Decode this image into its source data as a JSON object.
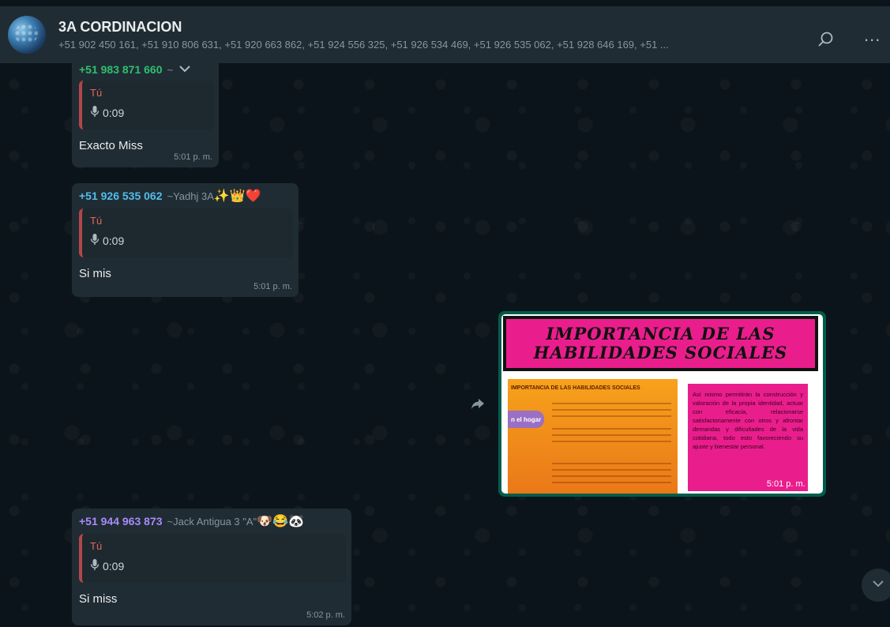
{
  "header": {
    "title": "3A CORDINACION",
    "participants": "+51 902 450 161, +51 910 806 631, +51 920 663 862, +51 924 556 325, +51 926 534 469, +51 926 535 062, +51 928 646 169, +51 ...",
    "search_icon": "search-icon",
    "menu_icon": "more-options-icon",
    "menu_label": "..."
  },
  "messages": [
    {
      "phone": "+51 983 871 660",
      "alias": "~",
      "phone_color": "#2fbf71",
      "quote_author": "Tú",
      "quote_duration": "0:09",
      "text": "Exacto Miss",
      "time": "5:01 p. m."
    },
    {
      "phone": "+51 926 535 062",
      "alias": "~Yadhj 3A",
      "alias_emoji": "✨👑❤️",
      "phone_color": "#53bdeb",
      "quote_author": "Tú",
      "quote_duration": "0:09",
      "text": "Si mis",
      "time": "5:01 p. m."
    },
    {
      "phone": "+51 944 963 873",
      "alias": "~Jack Antigua 3 \"A\"",
      "alias_emoji": "🐶😂🐼",
      "phone_color": "#a78bfa",
      "quote_author": "Tú",
      "quote_duration": "0:09",
      "text": "Si miss",
      "time": "5:02 p. m."
    }
  ],
  "image_message": {
    "title_line1": "IMPORTANCIA DE LAS",
    "title_line2": "HABILIDADES SOCIALES",
    "left_title": "IMPORTANCIA DE LAS HABILIDADES SOCIALES",
    "left_pill": "n el hogar",
    "right_text": "Así mismo permitirán la construcción y valoración de la propia identidad, actuar con eficacia, relacionarse satisfactoriamente con otros y afrontar demandas y dificultades de la vida cotidiana, todo esto favoreciendo su ajuste y bienestar personal.",
    "time": "5:01 p. m. ✓",
    "bubble_color": "#005c4b"
  },
  "forward_icon": "forward-icon",
  "scroll_icon": "chevron-down-icon"
}
